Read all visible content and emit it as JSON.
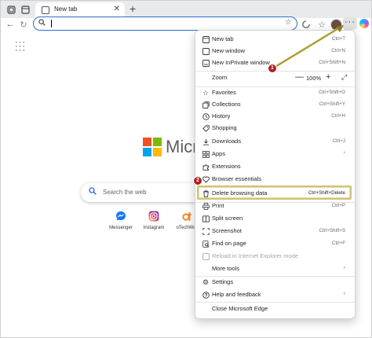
{
  "browser": {
    "tab_title": "New tab",
    "tab_close": "✕",
    "new_tab_glyph": "+"
  },
  "address_bar": {
    "placeholder": "",
    "value": ""
  },
  "page": {
    "logo_text": "Micr",
    "search_placeholder": "Search the web",
    "quick_links": [
      {
        "label": "Messenger",
        "color": "#1877f2",
        "icon": "messenger-icon"
      },
      {
        "label": "Instagram",
        "color": "#d6249f",
        "icon": "instagram-icon"
      },
      {
        "label": "oTechWor",
        "color": "#ffffff",
        "icon": "otechworld-icon"
      }
    ],
    "brand_colors": {
      "red": "#f25022",
      "green": "#7fba00",
      "blue": "#00a4ef",
      "yellow": "#ffb900"
    }
  },
  "menu": {
    "items": {
      "new_tab": {
        "label": "New tab",
        "shortcut": "Ctrl+T"
      },
      "new_window": {
        "label": "New window",
        "shortcut": "Ctrl+N"
      },
      "inprivate": {
        "label": "New InPrivate window",
        "shortcut": "Ctrl+Shift+N"
      },
      "zoom": {
        "label": "Zoom",
        "minus": "—",
        "value": "100%",
        "plus": "+"
      },
      "favorites": {
        "label": "Favorites",
        "shortcut": "Ctrl+Shift+O"
      },
      "collections": {
        "label": "Collections",
        "shortcut": "Ctrl+Shift+Y"
      },
      "history": {
        "label": "History",
        "shortcut": "Ctrl+H"
      },
      "shopping": {
        "label": "Shopping"
      },
      "downloads": {
        "label": "Downloads",
        "shortcut": "Ctrl+J"
      },
      "apps": {
        "label": "Apps"
      },
      "extensions": {
        "label": "Extensions"
      },
      "browser_essentials": {
        "label": "Browser essentials"
      },
      "delete_browsing_data": {
        "label": "Delete browsing data",
        "shortcut": "Ctrl+Shift+Delete"
      },
      "print": {
        "label": "Print",
        "shortcut": "Ctrl+P"
      },
      "split_screen": {
        "label": "Split screen"
      },
      "screenshot": {
        "label": "Screenshot",
        "shortcut": "Ctrl+Shift+S"
      },
      "find_on_page": {
        "label": "Find on page",
        "shortcut": "Ctrl+F"
      },
      "reload_ie": {
        "label": "Reload in Internet Explorer mode"
      },
      "more_tools": {
        "label": "More tools"
      },
      "settings": {
        "label": "Settings"
      },
      "help_feedback": {
        "label": "Help and feedback"
      },
      "close_edge": {
        "label": "Close Microsoft Edge"
      }
    }
  },
  "annotations": {
    "step1": "1",
    "step2": "2",
    "highlight_color": "#cfc273",
    "badge_color": "#b11f24"
  }
}
